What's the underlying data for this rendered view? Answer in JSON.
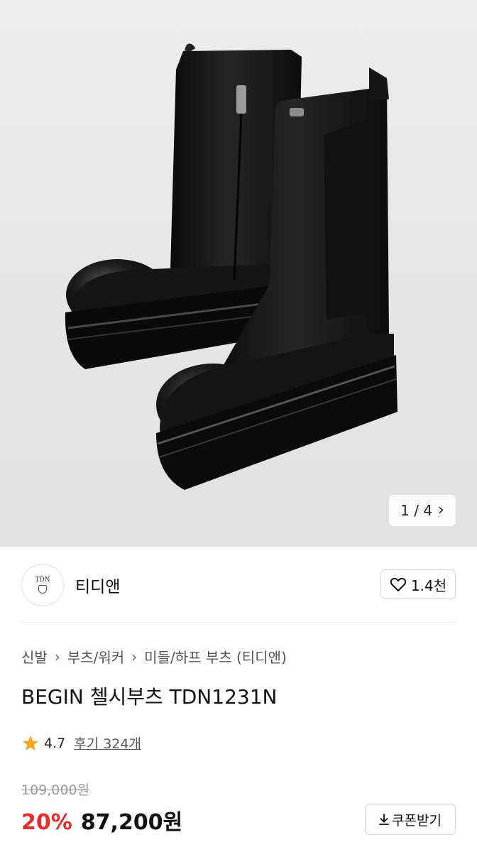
{
  "gallery": {
    "counter": "1 / 4",
    "image_alt": "black chelsea boots"
  },
  "brand": {
    "logo_text": "TDN",
    "name": "티디앤",
    "likes": "1.4천"
  },
  "breadcrumb": [
    "신발",
    "부츠/워커",
    "미들/하프 부츠 (티디앤)"
  ],
  "product": {
    "title": "BEGIN 첼시부츠 TDN1231N",
    "rating": "4.7",
    "reviews": "후기 324개",
    "original_price": "109,000원",
    "discount": "20%",
    "price": "87,200원",
    "coupon_label": "쿠폰받기"
  },
  "colors": {
    "discount": "#e62c2c",
    "star": "#f5a623"
  },
  "icons": {
    "next": "chevron-right-icon",
    "like": "heart-outline-icon",
    "star": "star-icon",
    "download": "download-icon"
  }
}
